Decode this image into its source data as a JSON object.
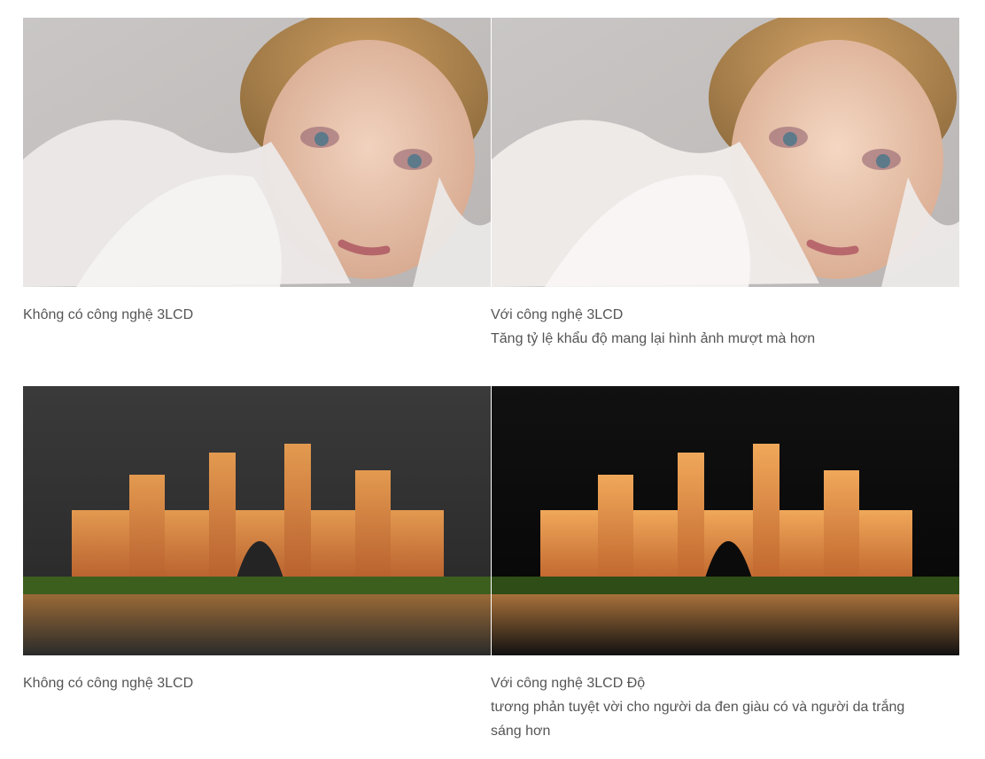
{
  "sections": [
    {
      "image_subject": "woman-portrait-comparison",
      "left_caption": [
        "Không có công nghệ 3LCD"
      ],
      "right_caption": [
        "Với công nghệ 3LCD",
        "Tăng tỷ lệ khẩu độ mang lại hình ảnh mượt mà hơn"
      ]
    },
    {
      "image_subject": "hotel-night-comparison",
      "left_caption": [
        "Không có công nghệ 3LCD"
      ],
      "right_caption": [
        "Với công nghệ 3LCD Độ",
        "tương phản tuyệt vời cho người da đen giàu có và người da trắng",
        "sáng hơn"
      ]
    }
  ]
}
